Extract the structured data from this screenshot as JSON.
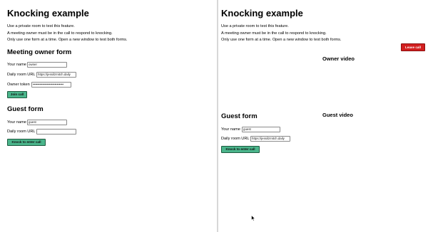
{
  "left": {
    "title": "Knocking example",
    "intro": [
      "Use a private room to test this feature.",
      "A meeting owner must be in the call to respond to knocking.",
      "Only use one form at a time. Open a new window to test both forms."
    ],
    "owner_form": {
      "heading": "Meeting owner form",
      "name_label": "Your name",
      "name_value": "owner",
      "url_label": "Daily room URL",
      "url_value": "https://jessilzmitch.daily",
      "token_label": "Owner token",
      "token_value": "••••••••••••••••••••••••••••",
      "join_label": "Join call"
    },
    "guest_form": {
      "heading": "Guest form",
      "name_label": "Your name",
      "name_value": "guest",
      "url_label": "Daily room URL",
      "url_value": "",
      "knock_label": "Knock to enter call"
    }
  },
  "right": {
    "title": "Knocking example",
    "intro": [
      "Use a private room to test this feature.",
      "A meeting owner must be in the call to respond to knocking.",
      "Only use one form at a time. Open a new window to test both forms."
    ],
    "leave_label": "Leave call",
    "owner_video_label": "Owner video",
    "guest_video_label": "Guest video",
    "guest_form": {
      "heading": "Guest form",
      "name_label": "Your name",
      "name_value": "guest",
      "url_label": "Daily room URL",
      "url_value": "https://jessilzmitch.daily",
      "knock_label": "Knock to enter call"
    }
  },
  "colors": {
    "primary_button": "#4ab58b",
    "danger_button": "#d21f1f"
  },
  "icons": {
    "cursor": "mouse-pointer-icon"
  }
}
